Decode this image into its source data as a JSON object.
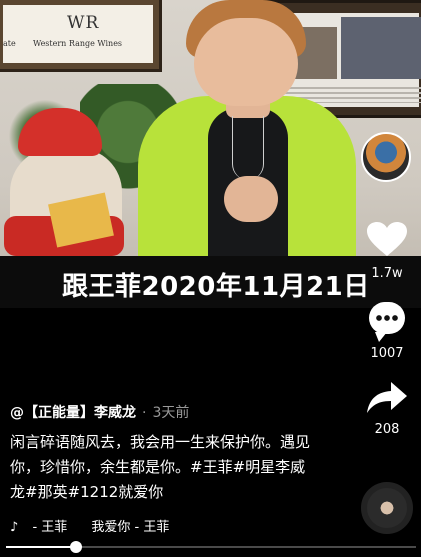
{
  "video": {
    "background_brand": "WR",
    "background_brand_text": "Western Range Wines",
    "background_left_fragment": "ate",
    "subtitle": "跟王菲2020年11月21日"
  },
  "rail": {
    "like_count": "1.7w",
    "comment_count": "1007",
    "share_count": "208",
    "icons": {
      "avatar": "author-avatar",
      "like": "heart-icon",
      "comment": "comment-bubble-icon",
      "share": "share-arrow-icon",
      "music_disc": "music-disc-icon"
    }
  },
  "post": {
    "author": "@【正能量】李威龙",
    "time": "3天前",
    "caption": "闲言碎语随风去，我会用一生来保护你。遇见你，珍惜你，余生都是你。#王菲#明星李威龙#那英#1212就爱你"
  },
  "music": {
    "note_icon": "tiktok-note-icon",
    "artist_prefix": "- 王菲",
    "track": "我爱你 - 王菲"
  },
  "progress": {
    "fraction": 0.17
  },
  "colors": {
    "background": "#000000",
    "jacket": "#b8e23a",
    "muted_text": "#999999"
  }
}
